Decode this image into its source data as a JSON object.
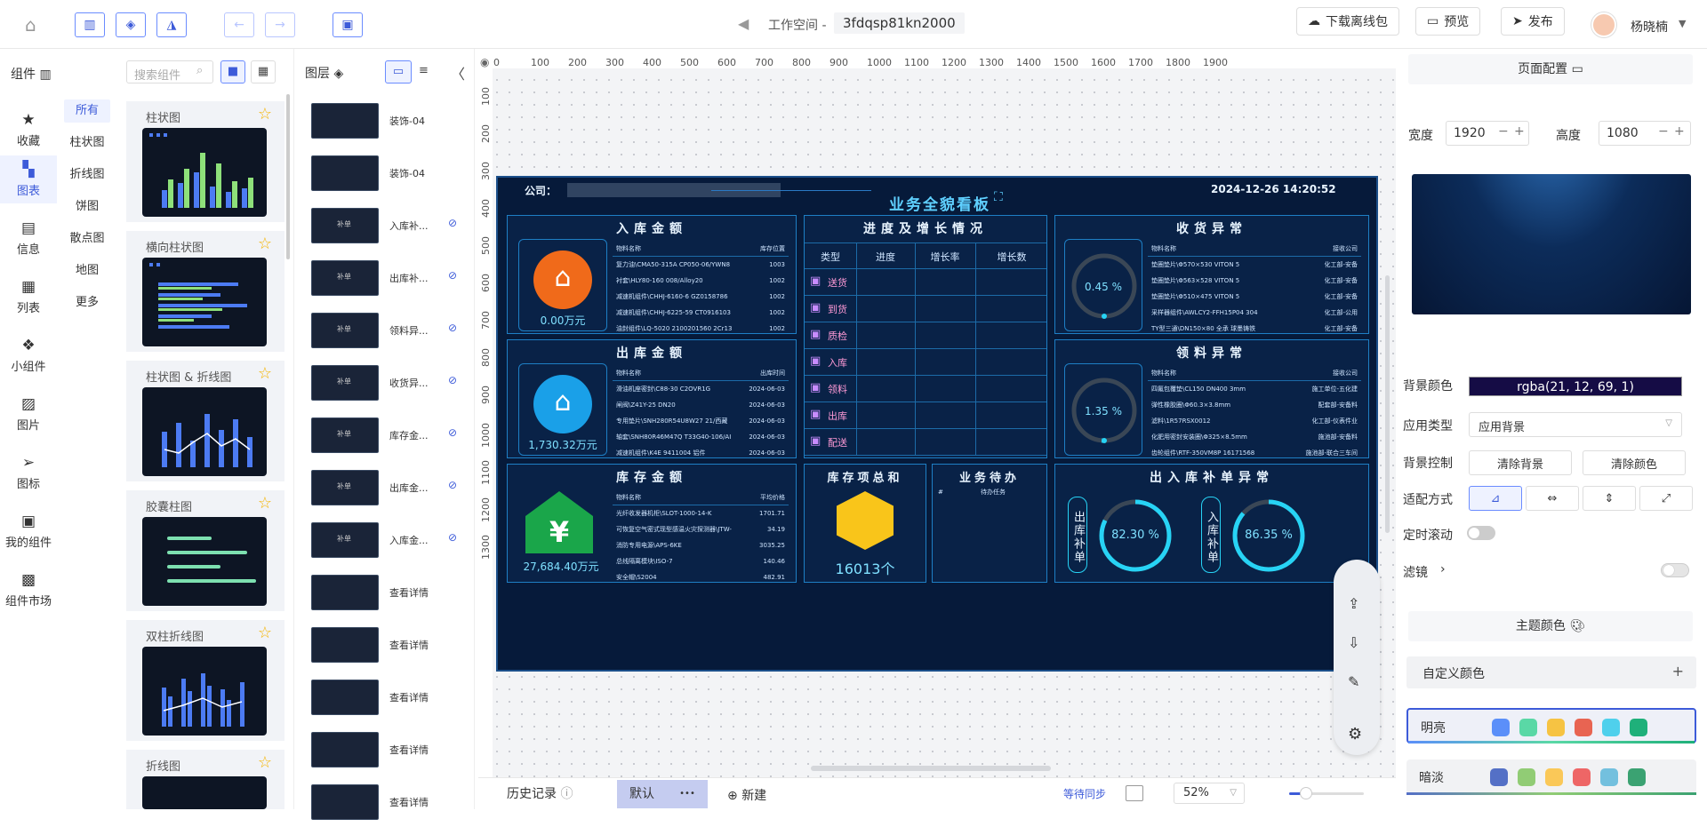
{
  "header": {
    "workspace_label": "工作空间 -",
    "workspace_id": "3fdqsp81kn2000",
    "download_label": "下载离线包",
    "preview_label": "预览",
    "publish_label": "发布",
    "user_name": "杨晓楠"
  },
  "left_nav": {
    "title": "组件",
    "items": [
      {
        "label": "收藏",
        "icon": "star-icon"
      },
      {
        "label": "图表",
        "icon": "chart-icon"
      },
      {
        "label": "信息",
        "icon": "info-icon"
      },
      {
        "label": "列表",
        "icon": "table-icon"
      },
      {
        "label": "小组件",
        "icon": "widget-icon"
      },
      {
        "label": "图片",
        "icon": "image-icon"
      },
      {
        "label": "图标",
        "icon": "send-icon"
      },
      {
        "label": "我的组件",
        "icon": "my-component-icon"
      },
      {
        "label": "组件市场",
        "icon": "market-icon"
      }
    ]
  },
  "component_panel": {
    "search_placeholder": "搜索组件",
    "subcategories": [
      "所有",
      "柱状图",
      "折线图",
      "饼图",
      "散点图",
      "地图",
      "更多"
    ],
    "cards": [
      "柱状图",
      "横向柱状图",
      "柱状图 & 折线图",
      "胶囊柱图",
      "双柱折线图",
      "折线图"
    ]
  },
  "layers_panel": {
    "title": "图层",
    "items": [
      {
        "name": "装饰-04",
        "thumb": ""
      },
      {
        "name": "装饰-04",
        "thumb": ""
      },
      {
        "name": "入库补...",
        "thumb": "补单"
      },
      {
        "name": "出库补...",
        "thumb": "补单"
      },
      {
        "name": "领料异...",
        "thumb": "补单"
      },
      {
        "name": "收货异...",
        "thumb": "补单"
      },
      {
        "name": "库存金...",
        "thumb": "补单"
      },
      {
        "name": "出库金...",
        "thumb": "补单"
      },
      {
        "name": "入库金...",
        "thumb": "补单"
      },
      {
        "name": "查看详情",
        "thumb": ""
      },
      {
        "name": "查看详情",
        "thumb": ""
      },
      {
        "name": "查看详情",
        "thumb": ""
      },
      {
        "name": "查看详情",
        "thumb": ""
      },
      {
        "name": "查看详情",
        "thumb": ""
      }
    ]
  },
  "ruler": {
    "x": [
      "0",
      "100",
      "200",
      "300",
      "400",
      "500",
      "600",
      "700",
      "800",
      "900",
      "1000",
      "1100",
      "1200",
      "1300",
      "1400",
      "1500",
      "1600",
      "1700",
      "1800",
      "1900"
    ],
    "y": [
      "100",
      "200",
      "300",
      "400",
      "500",
      "600",
      "700",
      "800",
      "900",
      "1000",
      "1100",
      "1200",
      "1300"
    ]
  },
  "dashboard": {
    "company_label": "公司：",
    "title": "业务全貌看板",
    "datetime": "2024-12-26 14:20:52",
    "inbound": {
      "title": "入库金额",
      "amount": "0.00万元",
      "headers": [
        "物料名称",
        "库存位置"
      ],
      "rows": [
        [
          "复力油\\CMA50-315A CP050-06/YWN8",
          "1003"
        ],
        [
          "衬套\\HLY80-160 008/Alloy20",
          "1002"
        ],
        [
          "减速机组件\\CHHJ-6160-6 GZ0158786",
          "1002"
        ],
        [
          "减速机组件\\CHHJ-6225-59 CT0916103",
          "1002"
        ],
        [
          "油封组件\\LQ-5020 2100201560 2Cr13",
          "1002"
        ]
      ]
    },
    "outbound": {
      "title": "出库金额",
      "amount": "1,730.32万元",
      "headers": [
        "物料名称",
        "出库时间"
      ],
      "rows": [
        [
          "滑油机座密封\\C88-30 C2OVR1G",
          "2024-06-03"
        ],
        [
          "闸阀\\Z41Y-25 DN20",
          "2024-06-03"
        ],
        [
          "专用垫片\\SNH280R54U8W27 21/西藏",
          "2024-06-03"
        ],
        [
          "轴套\\SNH80R46M47Q T33G40-106/AI",
          "2024-06-03"
        ],
        [
          "减速机组件\\K4E 9411004 铝件",
          "2024-06-03"
        ]
      ]
    },
    "stock": {
      "title": "库存金额",
      "amount": "27,684.40万元",
      "headers": [
        "物料名称",
        "平均价格"
      ],
      "rows": [
        [
          "光纤收发器机柜\\SLOT-1000-14-K",
          "1701.71"
        ],
        [
          "可恢复空气密式现型感温火灾探测器\\JTW-",
          "34.19"
        ],
        [
          "消防专用电源\\APS-6KE",
          "3035.25"
        ],
        [
          "总线隔离模块\\ISO-7",
          "140.46"
        ],
        [
          "安全帽\\S2004",
          "482.91"
        ]
      ]
    },
    "progress": {
      "title": "进度及增长情况",
      "headers": [
        "类型",
        "进度",
        "增长率",
        "增长数"
      ],
      "types": [
        "送货",
        "到货",
        "质检",
        "入库",
        "领料",
        "出库",
        "配送"
      ]
    },
    "receive": {
      "title": "收货异常",
      "percent": "0.45 %",
      "value": 0.45,
      "headers": [
        "物料名称",
        "接收公司"
      ],
      "rows": [
        [
          "垫圈垫片\\Φ570×530 VITON 5",
          "化工部-安备"
        ],
        [
          "垫圈垫片\\Φ563×528 VITON 5",
          "化工部-安备"
        ],
        [
          "垫圈垫片\\Φ510×475 VITON 5",
          "化工部-安备"
        ],
        [
          "采样器组件\\AWLCY2-FFH15P04 304",
          "化工部-公用"
        ],
        [
          "TY型三通\\DN150×80 全承 球墨铸铁",
          "化工部-安备"
        ]
      ]
    },
    "material": {
      "title": "领料异常",
      "percent": "1.35 %",
      "value": 1.35,
      "headers": [
        "物料名称",
        "接收公司"
      ],
      "rows": [
        [
          "四氟包覆垫\\CL150 DN400 3mm",
          "施工单位-五化建"
        ],
        [
          "弹性橡胶圈\\Φ60.3×3.8mm",
          "配套部-安备料"
        ],
        [
          "滤料\\1R57RSX0012",
          "化工部-仪表件业"
        ],
        [
          "化肥用密封安装圈\\Φ325×8.5mm",
          "施池部-安备料"
        ],
        [
          "齿轮组件\\RTF-350VM8P 16171568",
          "施池部-联合三车间"
        ]
      ]
    },
    "inventory_total": {
      "title": "库存项总和",
      "count": "16013个"
    },
    "todo": {
      "title": "业务待办",
      "col1": "#",
      "col2": "待办任务"
    },
    "replenish": {
      "title": "出入库补单异常",
      "outbound_label": "出库补单",
      "outbound_percent": "82.30 %",
      "outbound_value": 82.3,
      "inbound_label": "入库补单",
      "inbound_percent": "86.35 %",
      "inbound_value": 86.35
    }
  },
  "bottom": {
    "history": "历史记录",
    "default": "默认",
    "more": "•••",
    "new": "新建",
    "sync": "等待同步",
    "zoom": "52%"
  },
  "right_panel": {
    "page_config": "页面配置",
    "width_label": "宽度",
    "width_value": "1920",
    "height_label": "高度",
    "height_value": "1080",
    "bg_color_label": "背景颜色",
    "bg_color_value": "rgba(21, 12, 69, 1)",
    "app_type_label": "应用类型",
    "app_type_value": "应用背景",
    "bg_control_label": "背景控制",
    "clear_bg": "清除背景",
    "clear_color": "清除颜色",
    "fit_label": "适配方式",
    "timed_scroll_label": "定时滚动",
    "filter_label": "滤镜",
    "theme_color_label": "主题颜色",
    "custom_color_label": "自定义颜色",
    "themes": [
      {
        "name": "明亮",
        "colors": [
          "#5b8ff9",
          "#5ad8a6",
          "#f6c343",
          "#e86452",
          "#4fd0ec",
          "#1fb07a"
        ]
      },
      {
        "name": "暗淡",
        "colors": [
          "#5470c6",
          "#91cc75",
          "#fac858",
          "#ee6666",
          "#73c0de",
          "#3ba272"
        ]
      }
    ]
  }
}
